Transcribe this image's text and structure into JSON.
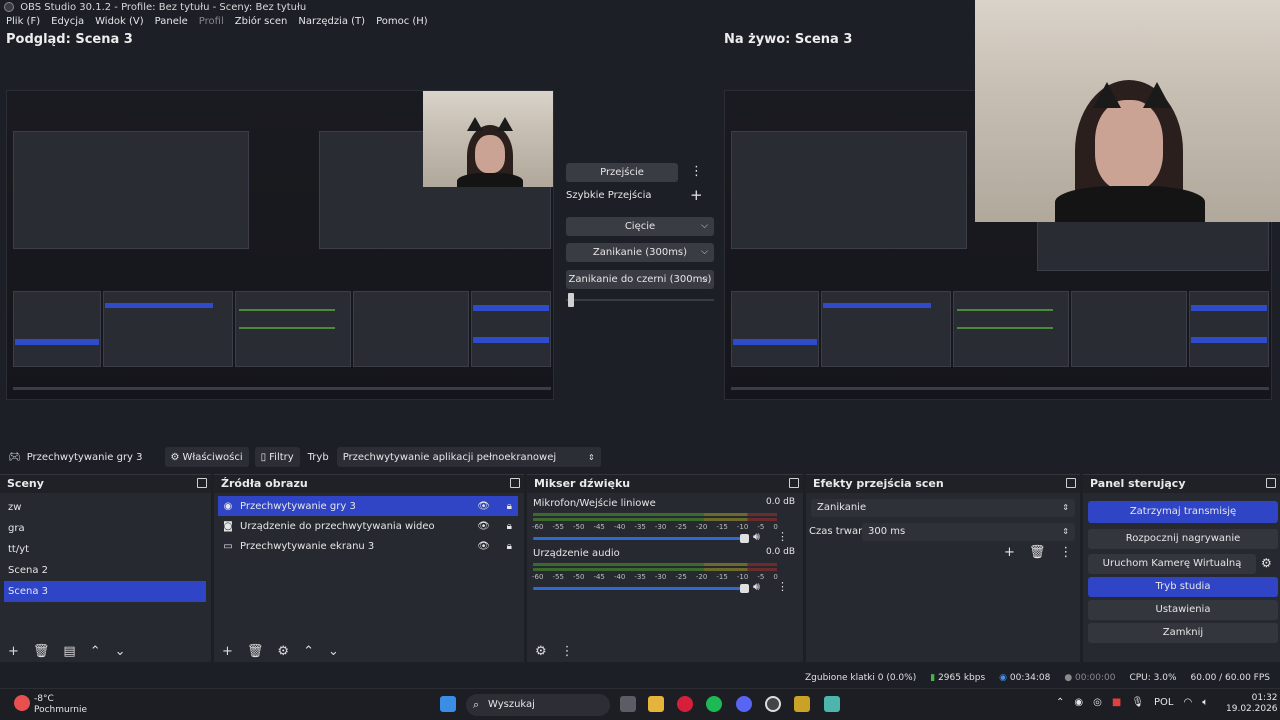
{
  "window": {
    "title": "OBS Studio 30.1.2 - Profile: Bez tytułu - Sceny: Bez tytułu"
  },
  "menu": [
    "Plik (F)",
    "Edycja",
    "Widok (V)",
    "Panele",
    "Profil",
    "Zbiór scen",
    "Narzędzia (T)",
    "Pomoc (H)"
  ],
  "preview": {
    "title": "Podgląd: Scena 3",
    "live_title": "Na żywo: Scena 3"
  },
  "transitions": {
    "transition_button": "Przejście",
    "quick_label": "Szybkie Przejścia",
    "cut": "Cięcie",
    "fade": "Zanikanie (300ms)",
    "fade_black": "Zanikanie do czerni (300ms)"
  },
  "source_toolbar": {
    "source_name": "Przechwytywanie gry 3",
    "properties": "Właściwości",
    "filters": "Filtry",
    "mode_label": "Tryb",
    "mode_value": "Przechwytywanie aplikacji pełnoekranowej"
  },
  "scenes": {
    "title": "Sceny",
    "items": [
      "zw",
      "gra",
      "tt/yt",
      "Scena 2",
      "Scena 3"
    ],
    "active_index": 4
  },
  "sources": {
    "title": "Źródła obrazu",
    "items": [
      {
        "label": "Przechwytywanie gry 3",
        "icon": "gamepad-icon"
      },
      {
        "label": "Urządzenie do przechwytywania wideo",
        "icon": "camera-icon"
      },
      {
        "label": "Przechwytywanie ekranu 3",
        "icon": "monitor-icon"
      }
    ]
  },
  "mixer": {
    "title": "Mikser dźwięku",
    "channels": [
      {
        "name": "Mikrofon/Wejście liniowe",
        "db": "0.0 dB",
        "volume": 0.95
      },
      {
        "name": "Urządzenie audio",
        "db": "0.0 dB",
        "volume": 0.95
      }
    ],
    "ticks": [
      "-60",
      "-55",
      "-50",
      "-45",
      "-40",
      "-35",
      "-30",
      "-25",
      "-20",
      "-15",
      "-10",
      "-5",
      "0"
    ]
  },
  "effects": {
    "title": "Efekty przejścia scen",
    "transition": "Zanikanie",
    "duration_label": "Czas trwania",
    "duration_value": "300 ms"
  },
  "controls": {
    "title": "Panel sterujący",
    "stop_stream": "Zatrzymaj transmisję",
    "start_record": "Rozpocznij nagrywanie",
    "virtual_cam": "Uruchom Kamerę Wirtualną",
    "studio_mode": "Tryb studia",
    "settings": "Ustawienia",
    "exit": "Zamknij"
  },
  "status": {
    "dropped": "Zgubione klatki 0 (0.0%)",
    "bitrate": "2965 kbps",
    "stream_time": "00:34:08",
    "rec_time": "00:00:00",
    "cpu": "CPU: 3.0%",
    "fps": "60.00 / 60.00 FPS"
  },
  "taskbar": {
    "weather_temp": "-8°C",
    "weather_desc": "Pochmurnie",
    "search": "Wyszukaj",
    "lang": "POL",
    "time": "01:32",
    "date": "19.02.2026"
  },
  "colors": {
    "accent": "#2f45c6",
    "panel": "#272930",
    "background": "#1d1f26"
  }
}
